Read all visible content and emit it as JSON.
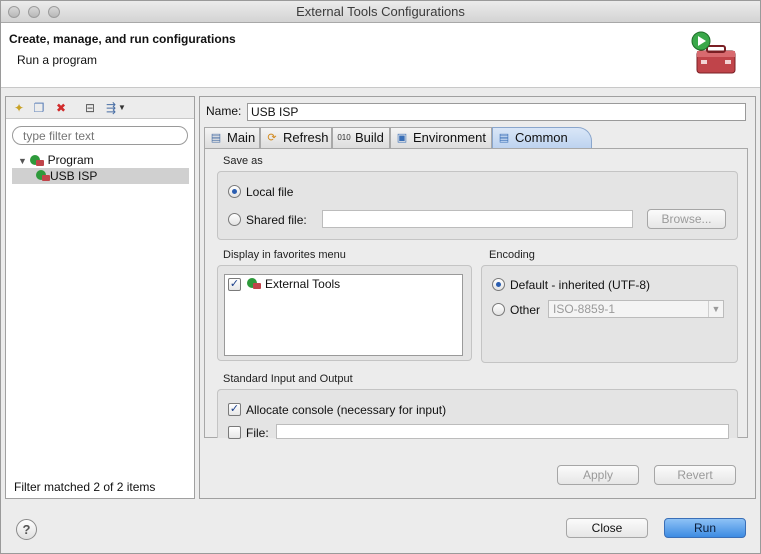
{
  "window": {
    "title": "External Tools Configurations"
  },
  "header": {
    "title": "Create, manage, and run configurations",
    "subtitle": "Run a program",
    "icon": "toolbox-icon"
  },
  "left": {
    "filter_placeholder": "type filter text",
    "tree": {
      "program": "Program",
      "usb": "USB ISP"
    },
    "status": "Filter matched 2 of 2 items"
  },
  "right": {
    "name_label": "Name:",
    "name_value": "USB ISP",
    "tabs": [
      {
        "label": "Main",
        "icon": "main-tab-icon"
      },
      {
        "label": "Refresh",
        "icon": "refresh-icon"
      },
      {
        "label": "Build",
        "icon": "build-icon"
      },
      {
        "label": "Environment",
        "icon": "environment-icon"
      },
      {
        "label": "Common",
        "icon": "common-icon"
      }
    ],
    "selected_tab": "Common",
    "save_as": {
      "label": "Save as",
      "local_file": "Local file",
      "shared_file": "Shared file:",
      "browse": "Browse..."
    },
    "favorites": {
      "label": "Display in favorites menu",
      "item": "External Tools"
    },
    "encoding": {
      "label": "Encoding",
      "default": "Default - inherited (UTF-8)",
      "other": "Other",
      "other_value": "ISO-8859-1"
    },
    "std": {
      "label": "Standard Input and Output",
      "allocate": "Allocate console (necessary for input)",
      "file": "File:"
    },
    "apply": "Apply",
    "revert": "Revert"
  },
  "footer": {
    "help": "?",
    "close": "Close",
    "run": "Run"
  },
  "colors": {
    "accent": "#3d8be2",
    "tab_selected": "#bcd2ef",
    "run_icon": "#2e9a3b"
  }
}
